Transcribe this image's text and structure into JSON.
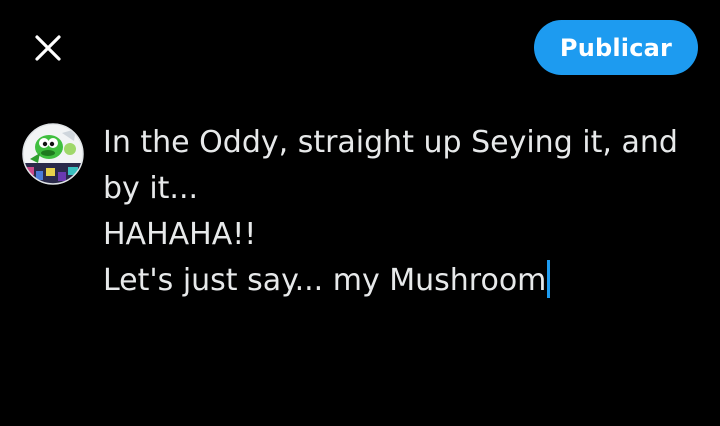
{
  "header": {
    "close_icon": "close-icon",
    "publish_label": "Publicar"
  },
  "composer": {
    "avatar": "user-avatar",
    "lines": [
      "In the Oddy, straight up Seying it, and",
      "by it...",
      "HAHAHA!!",
      "Let's just say... my Mushroom"
    ]
  },
  "colors": {
    "background": "#000000",
    "accent": "#1d9bf0",
    "text": "#e7e9ea",
    "icon": "#ffffff"
  }
}
